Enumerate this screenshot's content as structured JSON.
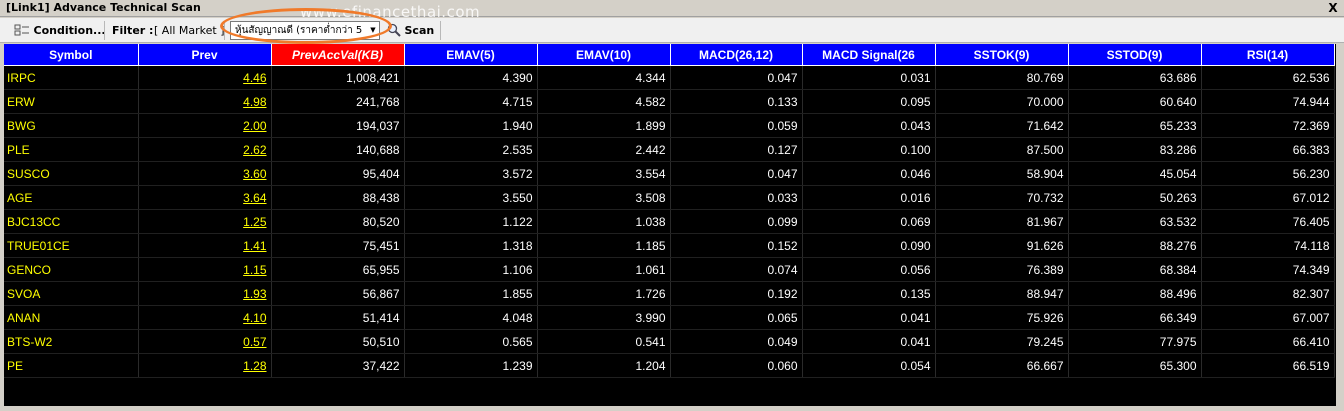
{
  "window": {
    "title": "[Link1] Advance Technical Scan",
    "close_label": "X"
  },
  "toolbar": {
    "condition_label": "Condition...",
    "filter_label": "Filter :",
    "filter_value": "[ All Market ]",
    "select_value": "หุ้นสัญญาณดี (ราคาต่ำกว่า 5",
    "scan_label": "Scan"
  },
  "watermark": "www.efinancethai.com",
  "columns": [
    "Symbol",
    "Prev",
    "PrevAccVal(KB)",
    "EMAV(5)",
    "EMAV(10)",
    "MACD(26,12)",
    "MACD Signal(26",
    "SSTOK(9)",
    "SSTOD(9)",
    "RSI(14)"
  ],
  "sorted_column": "PrevAccVal(KB)",
  "rows": [
    [
      "IRPC",
      "4.46",
      "1,008,421",
      "4.390",
      "4.344",
      "0.047",
      "0.031",
      "80.769",
      "63.686",
      "62.536"
    ],
    [
      "ERW",
      "4.98",
      "241,768",
      "4.715",
      "4.582",
      "0.133",
      "0.095",
      "70.000",
      "60.640",
      "74.944"
    ],
    [
      "BWG",
      "2.00",
      "194,037",
      "1.940",
      "1.899",
      "0.059",
      "0.043",
      "71.642",
      "65.233",
      "72.369"
    ],
    [
      "PLE",
      "2.62",
      "140,688",
      "2.535",
      "2.442",
      "0.127",
      "0.100",
      "87.500",
      "83.286",
      "66.383"
    ],
    [
      "SUSCO",
      "3.60",
      "95,404",
      "3.572",
      "3.554",
      "0.047",
      "0.046",
      "58.904",
      "45.054",
      "56.230"
    ],
    [
      "AGE",
      "3.64",
      "88,438",
      "3.550",
      "3.508",
      "0.033",
      "0.016",
      "70.732",
      "50.263",
      "67.012"
    ],
    [
      "BJC13CC",
      "1.25",
      "80,520",
      "1.122",
      "1.038",
      "0.099",
      "0.069",
      "81.967",
      "63.532",
      "76.405"
    ],
    [
      "TRUE01CE",
      "1.41",
      "75,451",
      "1.318",
      "1.185",
      "0.152",
      "0.090",
      "91.626",
      "88.276",
      "74.118"
    ],
    [
      "GENCO",
      "1.15",
      "65,955",
      "1.106",
      "1.061",
      "0.074",
      "0.056",
      "76.389",
      "68.384",
      "74.349"
    ],
    [
      "SVOA",
      "1.93",
      "56,867",
      "1.855",
      "1.726",
      "0.192",
      "0.135",
      "88.947",
      "88.496",
      "82.307"
    ],
    [
      "ANAN",
      "4.10",
      "51,414",
      "4.048",
      "3.990",
      "0.065",
      "0.041",
      "75.926",
      "66.349",
      "67.007"
    ],
    [
      "BTS-W2",
      "0.57",
      "50,510",
      "0.565",
      "0.541",
      "0.049",
      "0.041",
      "79.245",
      "77.975",
      "66.410"
    ],
    [
      "PE",
      "1.28",
      "37,422",
      "1.239",
      "1.204",
      "0.060",
      "0.054",
      "66.667",
      "65.300",
      "66.519"
    ]
  ],
  "colors": {
    "header_bg": "#0000ff",
    "sorted_header_bg": "#ff0000",
    "grid_bg": "#000000",
    "symbol_text": "#ffff00",
    "value_text": "#ffffff",
    "highlight_ring": "#f07a2a"
  },
  "icons": {
    "condition": "condition-grid-icon",
    "scan": "magnifier-icon",
    "dropdown": "chevron-down-icon",
    "close": "close-icon"
  }
}
